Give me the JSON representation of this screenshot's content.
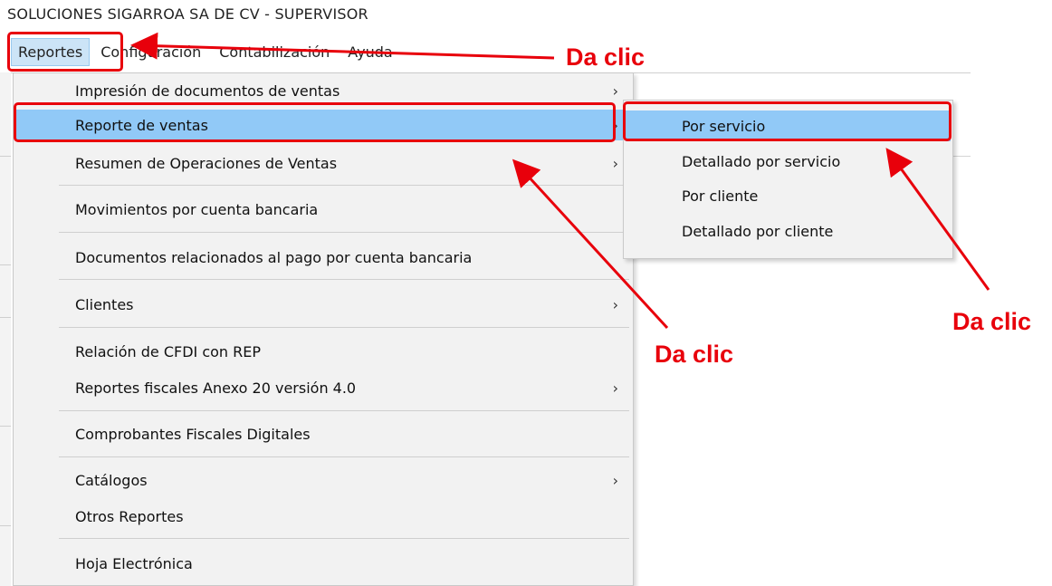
{
  "window": {
    "title": "SOLUCIONES SIGARROA SA DE CV  -  SUPERVISOR"
  },
  "menubar": [
    {
      "label": "Reportes"
    },
    {
      "label": "Configuración"
    },
    {
      "label": "Contabilización"
    },
    {
      "label": "Ayuda"
    }
  ],
  "menu": {
    "items": [
      {
        "label": "Impresión de documentos de ventas",
        "arrow": "›"
      },
      {
        "label": "Reporte de ventas",
        "arrow": "›"
      },
      {
        "label": "Resumen de Operaciones de Ventas",
        "arrow": "›"
      },
      {
        "label": "Movimientos por cuenta bancaria"
      },
      {
        "label": "Documentos relacionados al pago por cuenta bancaria"
      },
      {
        "label": "Clientes",
        "arrow": "›"
      },
      {
        "label": "Relación de CFDI con REP"
      },
      {
        "label": "Reportes fiscales Anexo 20 versión 4.0",
        "arrow": "›"
      },
      {
        "label": "Comprobantes Fiscales Digitales"
      },
      {
        "label": "Catálogos",
        "arrow": "›"
      },
      {
        "label": "Otros Reportes"
      },
      {
        "label": "Hoja Electrónica"
      }
    ]
  },
  "submenu": {
    "items": [
      {
        "label": "Por servicio"
      },
      {
        "label": "Detallado por servicio"
      },
      {
        "label": "Por cliente"
      },
      {
        "label": "Detallado por cliente"
      }
    ]
  },
  "annotations": {
    "note_menubar": "Da clic",
    "note_menu": "Da clic",
    "note_submenu": "Da clic",
    "color": "#e8000b"
  }
}
